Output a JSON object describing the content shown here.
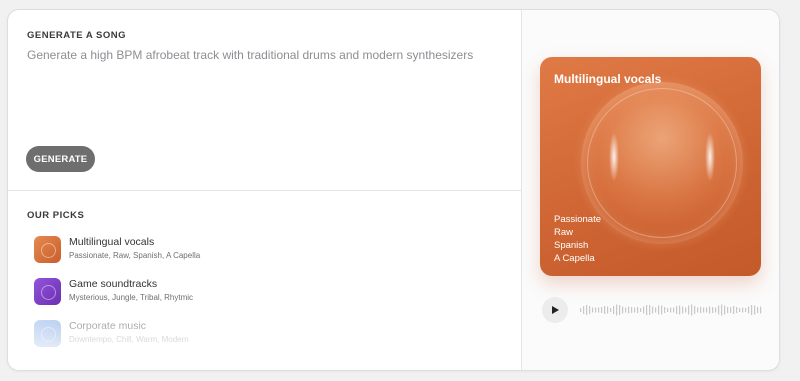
{
  "generate": {
    "section_label": "GENERATE A SONG",
    "prompt": "Generate a high BPM afrobeat track with traditional drums and modern synthesizers",
    "button_label": "GENERATE"
  },
  "picks": {
    "section_label": "OUR PICKS",
    "items": [
      {
        "name": "Multilingual vocals",
        "tags": "Passionate, Raw, Spanish, A Capella",
        "color": "#d9703c",
        "icon": "orb-icon"
      },
      {
        "name": "Game soundtracks",
        "tags": "Mysterious, Jungle, Tribal, Rhytmic",
        "color": "#7a3fc4",
        "icon": "orb-icon"
      },
      {
        "name": "Corporate music",
        "tags": "Downtempo, Chill, Warm, Modern",
        "color": "#6b9be0",
        "icon": "orb-icon"
      }
    ]
  },
  "feature": {
    "title": "Multilingual vocals",
    "tags": [
      "Passionate",
      "Raw",
      "Spanish",
      "A Capella"
    ],
    "color": "#d9703c"
  },
  "player": {
    "play_icon": "play-icon"
  }
}
